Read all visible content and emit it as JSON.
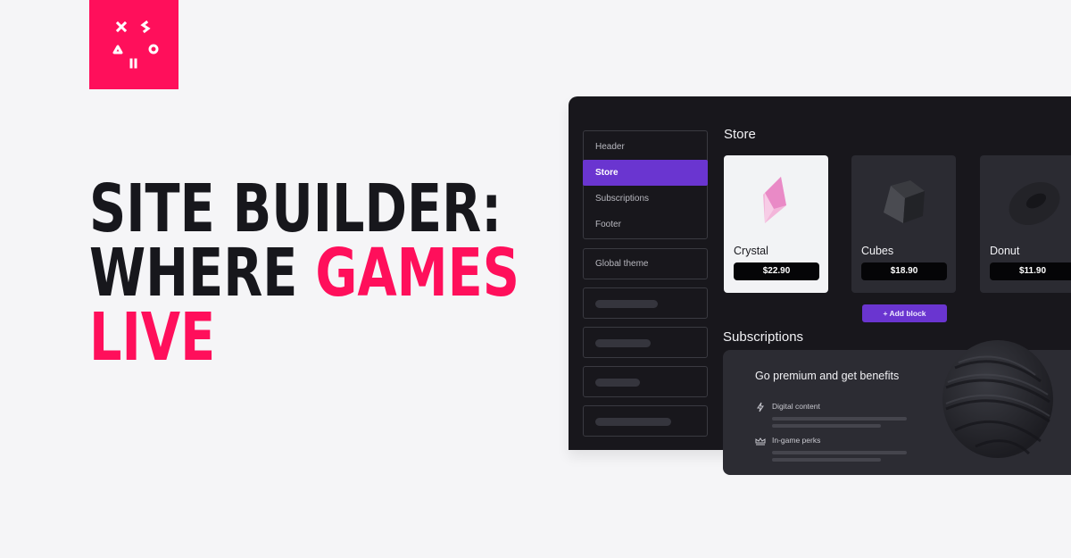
{
  "brand": {
    "accent_color": "#ff0f5b",
    "logo_icon": "game-controller-symbols-logo"
  },
  "headline": {
    "line1": "SITE BUILDER:",
    "line2_plain": "WHERE ",
    "line2_accent": "GAMES",
    "line3_accent": "LIVE"
  },
  "builder": {
    "sidebar": {
      "sections": [
        {
          "label": "Header",
          "active": false
        },
        {
          "label": "Store",
          "active": true
        },
        {
          "label": "Subscriptions",
          "active": false
        },
        {
          "label": "Footer",
          "active": false
        }
      ],
      "global_theme_label": "Global theme"
    },
    "store": {
      "title": "Store",
      "products": [
        {
          "name": "Crystal",
          "price": "$22.90",
          "icon": "crystal-icon"
        },
        {
          "name": "Cubes",
          "price": "$18.90",
          "icon": "cube-icon"
        },
        {
          "name": "Donut",
          "price": "$11.90",
          "icon": "donut-icon"
        }
      ],
      "add_block_label": "+ Add block"
    },
    "subscriptions": {
      "title": "Subscriptions",
      "card_title": "Go premium and get benefits",
      "perks": [
        {
          "label": "Digital content",
          "icon": "lightning-icon"
        },
        {
          "label": "In-game perks",
          "icon": "crown-icon"
        }
      ]
    },
    "colors": {
      "panel_bg": "#18171c",
      "active_item": "#6a35d0",
      "card_bg": "#2b2b32"
    }
  }
}
